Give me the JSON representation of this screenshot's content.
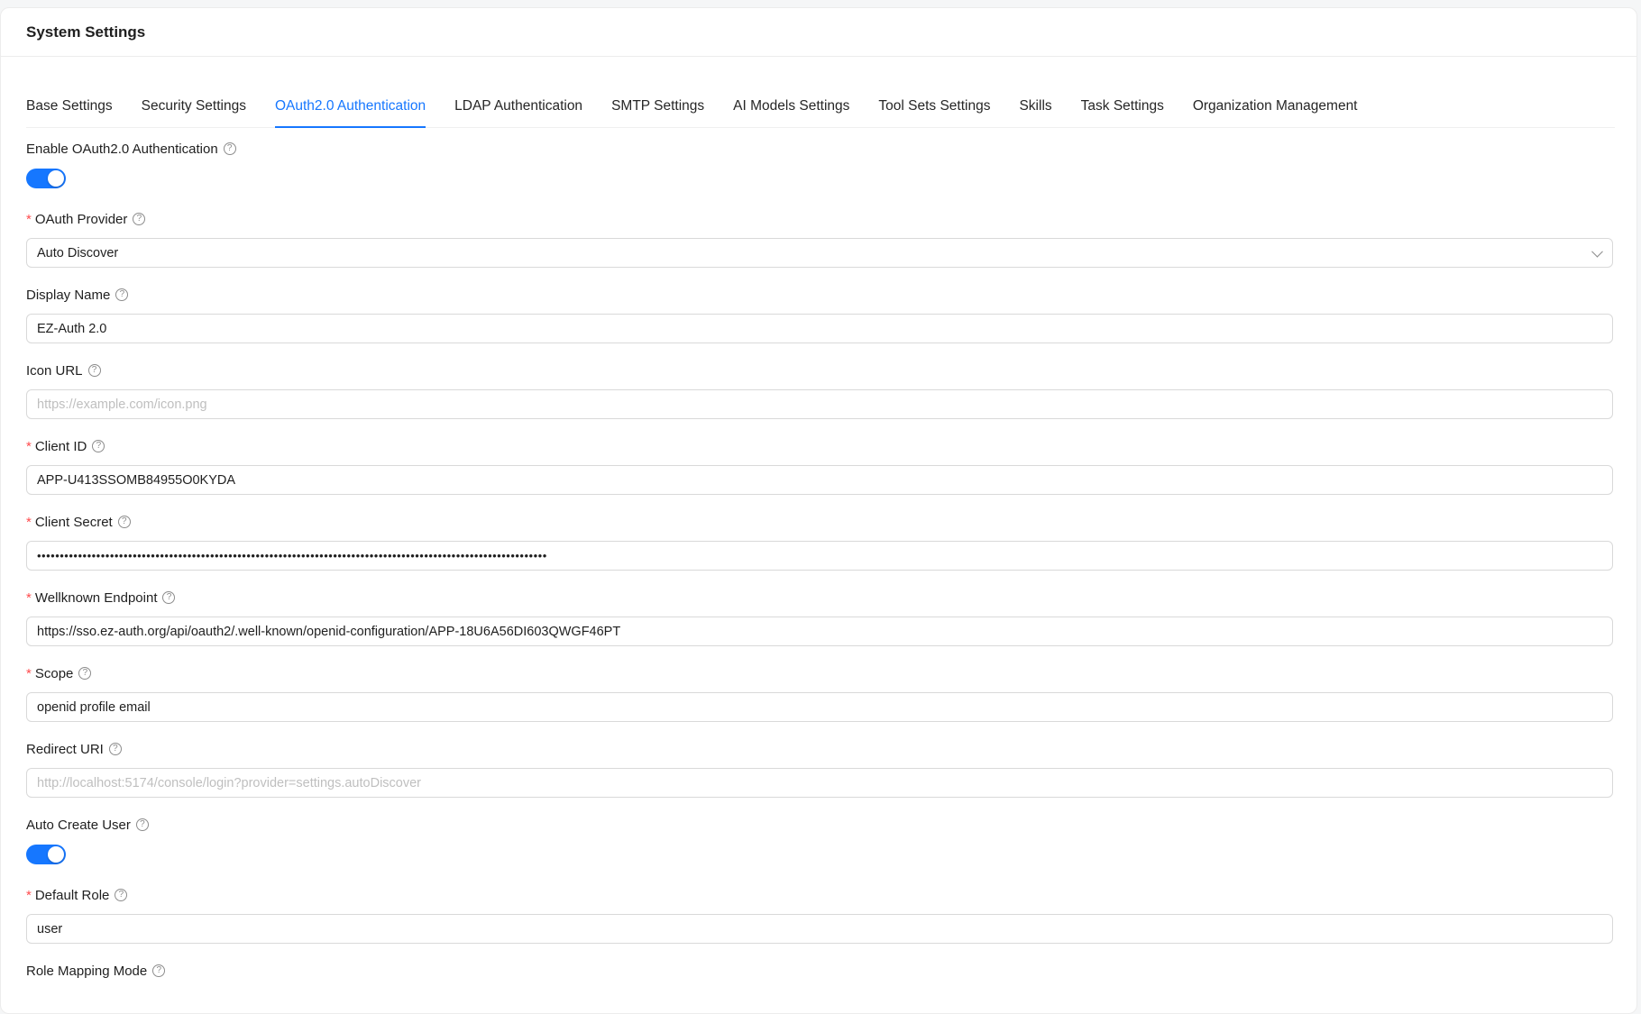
{
  "page": {
    "title": "System Settings"
  },
  "tabs": [
    {
      "label": "Base Settings"
    },
    {
      "label": "Security Settings"
    },
    {
      "label": "OAuth2.0 Authentication"
    },
    {
      "label": "LDAP Authentication"
    },
    {
      "label": "SMTP Settings"
    },
    {
      "label": "AI Models Settings"
    },
    {
      "label": "Tool Sets Settings"
    },
    {
      "label": "Skills"
    },
    {
      "label": "Task Settings"
    },
    {
      "label": "Organization Management"
    }
  ],
  "active_tab": "OAuth2.0 Authentication",
  "accent_color": "#1677ff",
  "form": {
    "enable_oauth": {
      "label": "Enable OAuth2.0 Authentication",
      "enabled": true
    },
    "oauth_provider": {
      "label": "OAuth Provider",
      "value": "Auto Discover",
      "required": true
    },
    "display_name": {
      "label": "Display Name",
      "value": "EZ-Auth 2.0"
    },
    "icon_url": {
      "label": "Icon URL",
      "value": "",
      "placeholder": "https://example.com/icon.png"
    },
    "client_id": {
      "label": "Client ID",
      "value": "APP-U413SSOMB84955O0KYDA",
      "required": true
    },
    "client_secret": {
      "label": "Client Secret",
      "value": "••••••••••••••••••••••••••••••••••••••••••••••••••••••••••••••••••••••••••••••••••••••••••••••••••••••••••••••••",
      "required": true
    },
    "wellknown_endpoint": {
      "label": "Wellknown Endpoint",
      "value": "https://sso.ez-auth.org/api/oauth2/.well-known/openid-configuration/APP-18U6A56DI603QWGF46PT",
      "required": true
    },
    "scope": {
      "label": "Scope",
      "value": "openid profile email",
      "required": true
    },
    "redirect_uri": {
      "label": "Redirect URI",
      "value": "",
      "placeholder": "http://localhost:5174/console/login?provider=settings.autoDiscover"
    },
    "auto_create_user": {
      "label": "Auto Create User",
      "enabled": true
    },
    "default_role": {
      "label": "Default Role",
      "value": "user",
      "required": true
    },
    "role_mapping_mode": {
      "label": "Role Mapping Mode"
    }
  },
  "icons": {
    "help": "question-circle-icon",
    "dropdown": "chevron-down-icon"
  },
  "required_mark": "*",
  "help_glyph": "?"
}
